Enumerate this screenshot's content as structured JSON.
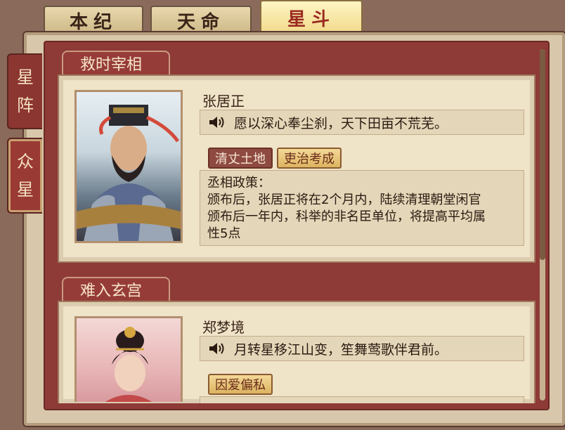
{
  "top_tabs": [
    {
      "label": "本纪",
      "active": false
    },
    {
      "label": "天命",
      "active": false
    },
    {
      "label": "星斗",
      "active": true
    }
  ],
  "side_tabs": [
    {
      "chars": [
        "星",
        "阵"
      ],
      "active": false
    },
    {
      "chars": [
        "众",
        "星"
      ],
      "active": true
    }
  ],
  "sections": [
    {
      "title": "救时宰相",
      "name": "张居正",
      "quote": "愿以深心奉尘刹，天下田亩不荒芜。",
      "tags": [
        {
          "label": "清丈土地",
          "style": "dark"
        },
        {
          "label": "吏治考成",
          "style": "gold"
        }
      ],
      "desc_lines": [
        "丞相政策：",
        "颁布后，张居正将在2个月内，陆续清理朝堂闲官",
        "颁布后一年内，科举的非名臣单位，将提高平均属",
        "性5点"
      ]
    },
    {
      "title": "难入玄宫",
      "name": "郑梦境",
      "quote": "月转星移江山变，笙舞莺歌伴君前。",
      "tags": [
        {
          "label": "因爱偏私",
          "style": "gold"
        }
      ]
    }
  ],
  "colors": {
    "panel": "#8e3a37",
    "card": "#efe3c8",
    "active_tab": "#f1d989",
    "tag_gold": "#dcb460",
    "tag_dark": "#8e4a40"
  }
}
